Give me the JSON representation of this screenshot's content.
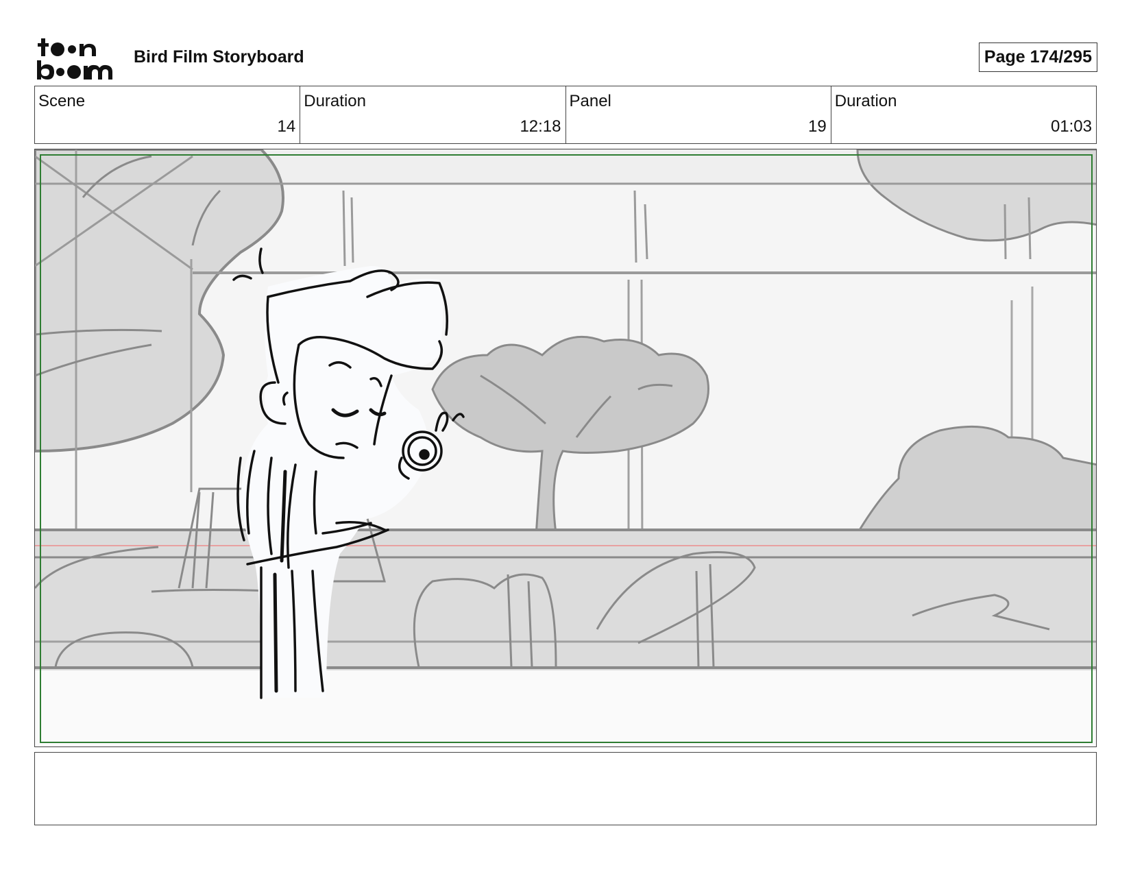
{
  "header": {
    "title": "Bird Film Storyboard",
    "page_label": "Page 174/295"
  },
  "info": {
    "scene_label": "Scene",
    "scene_value": "14",
    "scene_duration_label": "Duration",
    "scene_duration_value": "12:18",
    "panel_label": "Panel",
    "panel_value": "19",
    "panel_duration_label": "Duration",
    "panel_duration_value": "01:03"
  },
  "panel": {
    "safe_frame_color": "#2e7d32",
    "horizon_guide_color": "#e8a0a0",
    "sketch_color": "#111111",
    "background_sketch_color": "#8a8a8a"
  },
  "notes": {
    "text": ""
  }
}
